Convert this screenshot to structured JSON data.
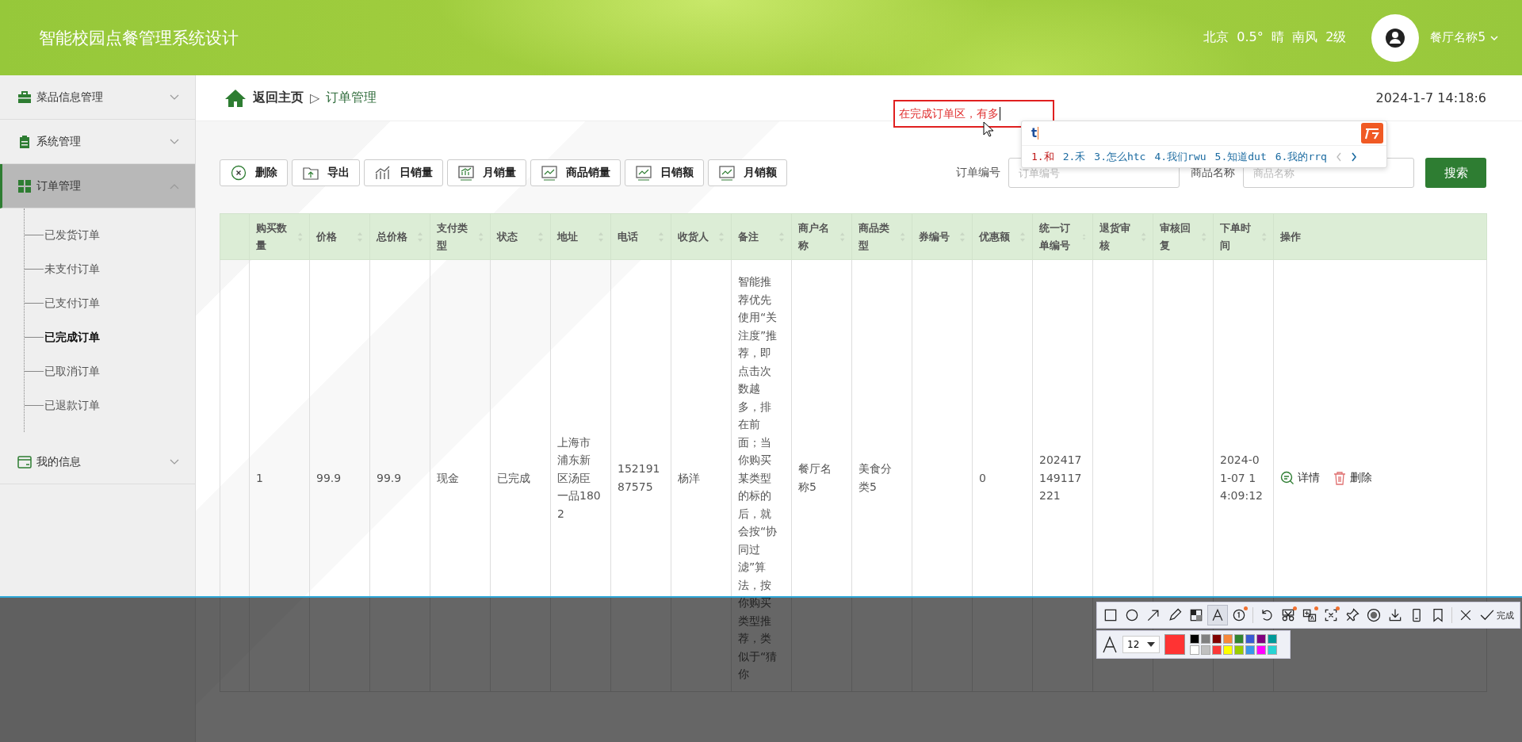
{
  "header": {
    "title": "智能校园点餐管理系统设计",
    "weather": "北京  0.5°  晴  南风  2级",
    "user": "餐厅名称5"
  },
  "sidebar": {
    "items": [
      {
        "label": "菜品信息管理",
        "expanded": false
      },
      {
        "label": "系统管理",
        "expanded": false
      },
      {
        "label": "订单管理",
        "expanded": true,
        "children": [
          {
            "label": "已发货订单",
            "selected": false
          },
          {
            "label": "未支付订单",
            "selected": false
          },
          {
            "label": "已支付订单",
            "selected": false
          },
          {
            "label": "已完成订单",
            "selected": true
          },
          {
            "label": "已取消订单",
            "selected": false
          },
          {
            "label": "已退款订单",
            "selected": false
          }
        ]
      },
      {
        "label": "我的信息",
        "expanded": false
      }
    ]
  },
  "breadcrumb": {
    "home": "返回主页",
    "separator": "▷",
    "current": "订单管理"
  },
  "datetime": "2024-1-7 14:18:6",
  "toolbar": {
    "buttons": [
      "删除",
      "导出",
      "日销量",
      "月销量",
      "商品销量",
      "日销额",
      "月销额"
    ]
  },
  "search": {
    "fields": [
      {
        "label": "订单编号",
        "placeholder": "订单编号"
      },
      {
        "label": "商品名称",
        "placeholder": "商品名称"
      }
    ],
    "button": "搜索"
  },
  "table": {
    "columns": [
      "购买数量",
      "价格",
      "总价格",
      "支付类型",
      "状态",
      "地址",
      "电话",
      "收货人",
      "备注",
      "商户名称",
      "商品类型",
      "券编号",
      "优惠额",
      "统一订单编号",
      "退货审核",
      "审核回复",
      "下单时间",
      "操作"
    ],
    "rows": [
      {
        "cells": [
          "1",
          "99.9",
          "99.9",
          "现金",
          "已完成",
          "上海市浦东新区汤臣一品1802",
          "15219187575",
          "杨洋",
          "智能推荐优先使用“关注度”推荐，即点击次数越多，排在前面；当你购买某类型的标的后，就会按“协同过滤”算法，按你购买类型推荐，类似于“猜你",
          "餐厅名称5",
          "美食分类5",
          "",
          "0",
          "202417149117221",
          "",
          "",
          "2024-01-07 14:09:12"
        ],
        "actions": [
          "详情",
          "删除"
        ]
      }
    ]
  },
  "annotation": {
    "text": "在完成订单区，有多"
  },
  "ime": {
    "input": "t",
    "candidates": [
      {
        "text": "1.和",
        "selected": true
      },
      {
        "text": "2.禾",
        "selected": false
      },
      {
        "text": "3.怎么htc",
        "selected": false
      },
      {
        "text": "4.我们rwu",
        "selected": false
      },
      {
        "text": "5.知道dut",
        "selected": false
      },
      {
        "text": "6.我的rrq",
        "selected": false
      }
    ]
  },
  "capture_toolbar": {
    "tools": [
      {
        "selected": false,
        "badge": false
      },
      {
        "selected": false,
        "badge": false
      },
      {
        "selected": false,
        "badge": false
      },
      {
        "selected": false,
        "badge": false
      },
      {
        "selected": false,
        "badge": false
      },
      {
        "selected": true,
        "badge": false
      },
      {
        "selected": false,
        "badge": true
      },
      {
        "selected": false,
        "badge": false
      },
      {
        "selected": false,
        "badge": true
      },
      {
        "selected": false,
        "badge": true
      },
      {
        "selected": false,
        "badge": true
      },
      {
        "selected": false,
        "badge": false
      },
      {
        "selected": false,
        "badge": false
      },
      {
        "selected": false,
        "badge": false
      },
      {
        "selected": false,
        "badge": false
      },
      {
        "selected": false,
        "badge": false
      },
      {
        "selected": false,
        "badge": false
      }
    ],
    "done": "完成",
    "font_size": "12",
    "current_swatch": {
      "color": "#ff3333"
    },
    "palette": [
      {
        "color": "#000000"
      },
      {
        "color": "#808080"
      },
      {
        "color": "#800000"
      },
      {
        "color": "#f7883a"
      },
      {
        "color": "#308430"
      },
      {
        "color": "#385ad3"
      },
      {
        "color": "#800080"
      },
      {
        "color": "#009999"
      },
      {
        "color": "#ffffff"
      },
      {
        "color": "#c0c0c0"
      },
      {
        "color": "#fb3838"
      },
      {
        "color": "#ffff00"
      },
      {
        "color": "#99cc00"
      },
      {
        "color": "#3896eb"
      },
      {
        "color": "#ff00ff"
      },
      {
        "color": "#27d4d4"
      }
    ]
  }
}
